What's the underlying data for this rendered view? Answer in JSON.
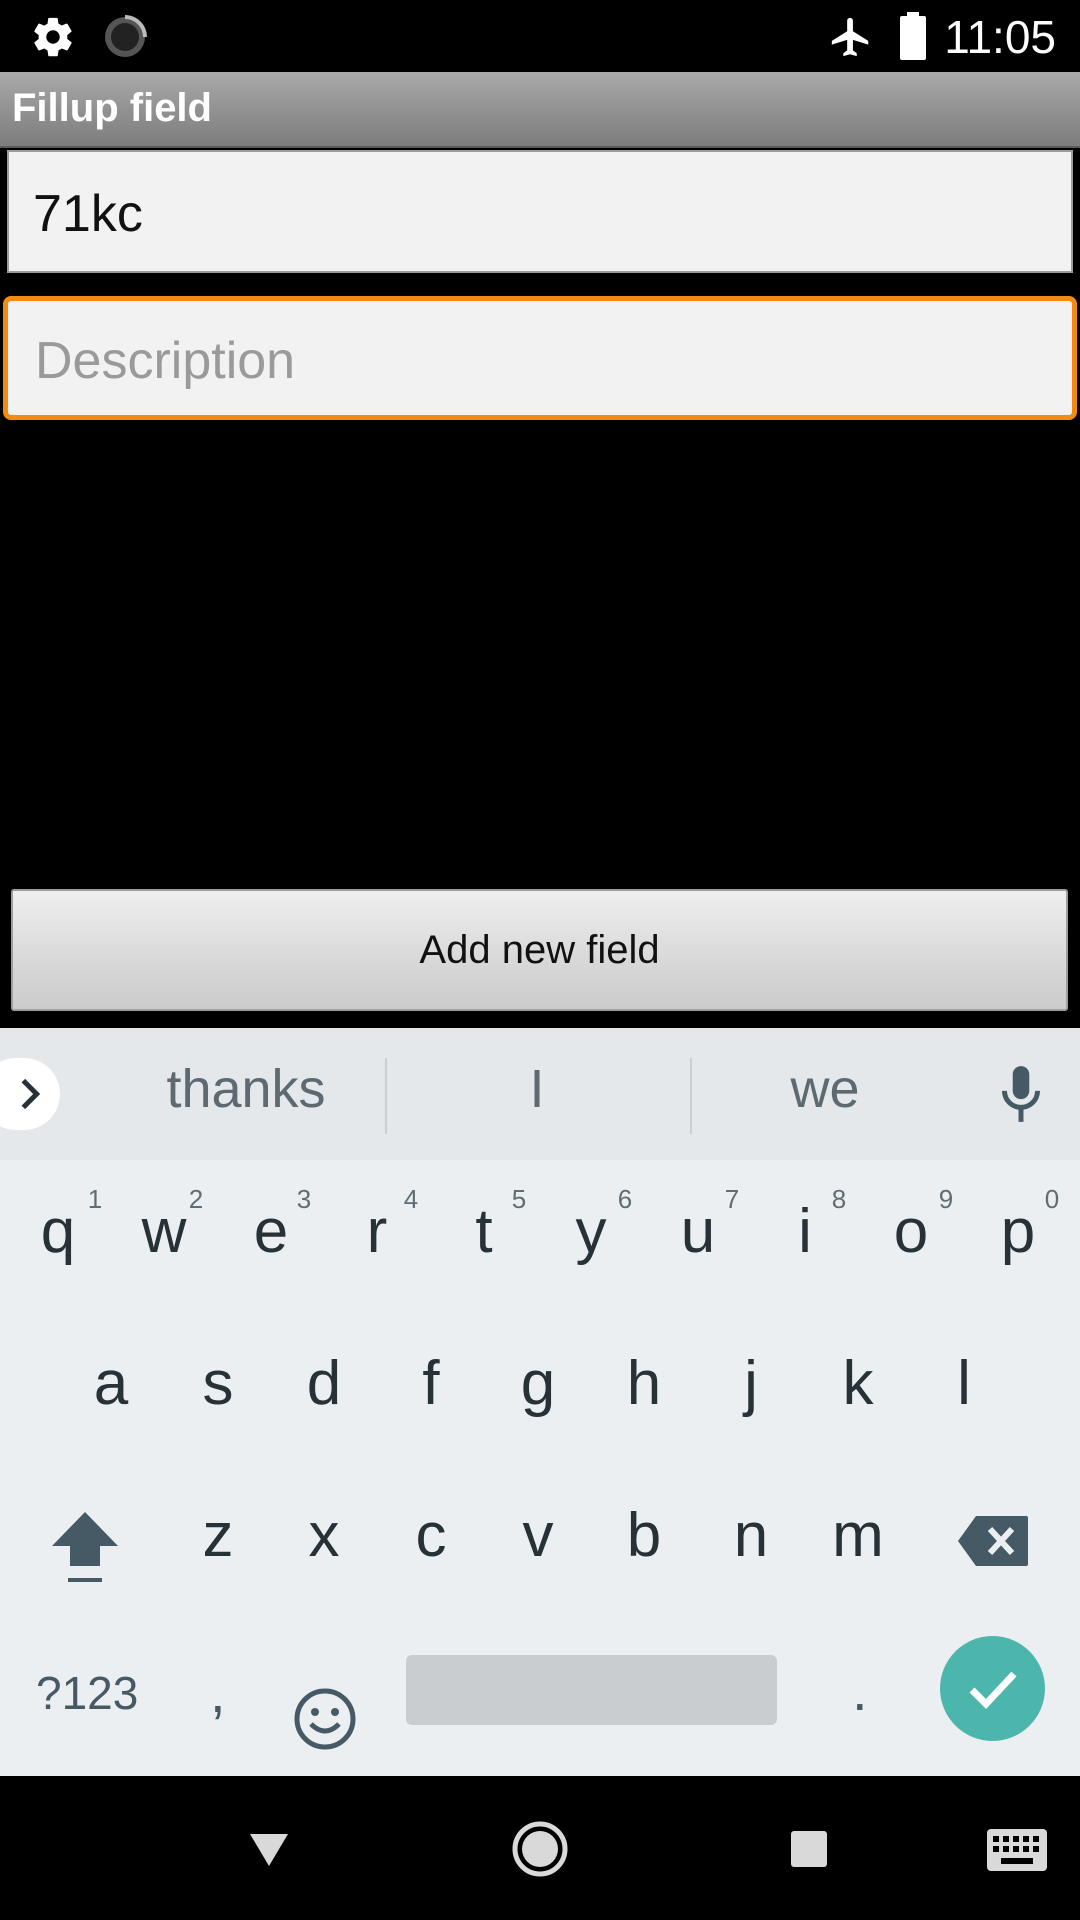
{
  "status_bar": {
    "time": "11:05"
  },
  "app": {
    "title": "Fillup field"
  },
  "form": {
    "name_value": "71kc",
    "description_placeholder": "Description",
    "add_button_label": "Add new field"
  },
  "keyboard": {
    "suggestions": [
      "thanks",
      "I",
      "we"
    ],
    "row1": [
      "q",
      "w",
      "e",
      "r",
      "t",
      "y",
      "u",
      "i",
      "o",
      "p"
    ],
    "row1_hints": [
      "1",
      "2",
      "3",
      "4",
      "5",
      "6",
      "7",
      "8",
      "9",
      "0"
    ],
    "row2": [
      "a",
      "s",
      "d",
      "f",
      "g",
      "h",
      "j",
      "k",
      "l"
    ],
    "row3": [
      "z",
      "x",
      "c",
      "v",
      "b",
      "n",
      "m"
    ],
    "symbols_label": "?123",
    "comma": ",",
    "period": ".",
    "accent_color": "#4db6ac"
  },
  "icons": {
    "status_left": [
      "gear-icon",
      "loading-spinner-icon"
    ],
    "status_right": [
      "airplane-mode-icon",
      "battery-icon"
    ],
    "keyboard": [
      "expand-chevron-icon",
      "microphone-icon",
      "shift-icon",
      "backspace-icon",
      "emoji-icon",
      "checkmark-icon"
    ],
    "nav": [
      "back-icon",
      "home-icon",
      "recents-icon",
      "keyboard-switch-icon"
    ]
  }
}
